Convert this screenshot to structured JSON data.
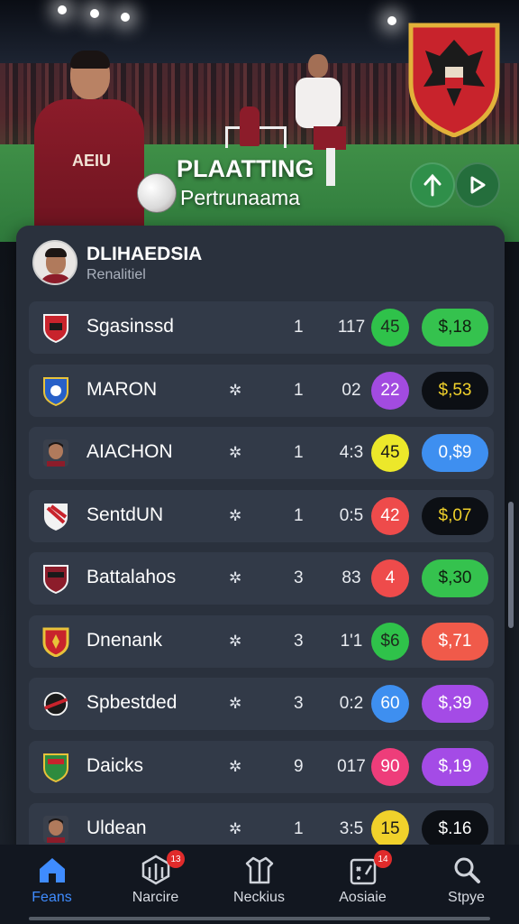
{
  "hero": {
    "title": "PLAATTING",
    "subtitle": "Pertrunaama",
    "jersey_text": "AEIU",
    "buttons": [
      {
        "icon": "arrow-up-icon"
      },
      {
        "icon": "chevron-right-icon"
      }
    ]
  },
  "panel": {
    "title": "DLIHAEDSIA",
    "subtitle": "Renalitiel"
  },
  "rows": [
    {
      "name": "Sgasinssd",
      "star": "",
      "n1": "1",
      "n2": "117",
      "circle": "45",
      "circle_color": "#2fc24a",
      "circle_text": "#1d2a1d",
      "pill": "$,18",
      "pill_color": "#35c24e",
      "pill_text": "#0f1f0f",
      "logo": "shield-red-icon"
    },
    {
      "name": "MARON",
      "star": "✲",
      "n1": "1",
      "n2": "02",
      "circle": "22",
      "circle_color": "#a24be0",
      "circle_text": "#ffffff",
      "pill": "$,53",
      "pill_color": "#0c0f14",
      "pill_text": "#f0d12b",
      "logo": "shield-blue-icon"
    },
    {
      "name": "AIACHON",
      "star": "✲",
      "n1": "1",
      "n2": "4:3",
      "circle": "45",
      "circle_color": "#ece82a",
      "circle_text": "#1a1a1a",
      "pill": "0,$9",
      "pill_color": "#3e8ff0",
      "pill_text": "#ffffff",
      "logo": "player-face-icon"
    },
    {
      "name": "SentdUN",
      "star": "✲",
      "n1": "1",
      "n2": "0:5",
      "circle": "42",
      "circle_color": "#ee4b4b",
      "circle_text": "#ffffff",
      "pill": "$,07",
      "pill_color": "#0c0f14",
      "pill_text": "#f0d12b",
      "logo": "shield-white-icon"
    },
    {
      "name": "Battalahos",
      "star": "✲",
      "n1": "3",
      "n2": "83",
      "circle": "4",
      "circle_color": "#ee4b4b",
      "circle_text": "#ffffff",
      "pill": "$,30",
      "pill_color": "#35c24e",
      "pill_text": "#0f1f0f",
      "logo": "shield-maroon-icon"
    },
    {
      "name": "Dnenank",
      "star": "✲",
      "n1": "3",
      "n2": "1'1",
      "circle": "$6",
      "circle_color": "#2fc24a",
      "circle_text": "#1d2a1d",
      "pill": "$,71",
      "pill_color": "#f05a4a",
      "pill_text": "#ffffff",
      "logo": "shield-gold-icon"
    },
    {
      "name": "Spbestded",
      "star": "✲",
      "n1": "3",
      "n2": "0:2",
      "circle": "60",
      "circle_color": "#3e8ff0",
      "circle_text": "#ffffff",
      "pill": "$,39",
      "pill_color": "#a44be6",
      "pill_text": "#ffffff",
      "logo": "club-dark-icon"
    },
    {
      "name": "Daicks",
      "star": "✲",
      "n1": "9",
      "n2": "017",
      "circle": "90",
      "circle_color": "#ee3d7a",
      "circle_text": "#ffffff",
      "pill": "$,19",
      "pill_color": "#a44be6",
      "pill_text": "#ffffff",
      "logo": "shield-green-icon"
    },
    {
      "name": "Uldean",
      "star": "✲",
      "n1": "1",
      "n2": "3:5",
      "circle": "15",
      "circle_color": "#f0d12b",
      "circle_text": "#1a1a1a",
      "pill": "$.16",
      "pill_color": "#0c0f14",
      "pill_text": "#ffffff",
      "logo": "player-face-icon"
    }
  ],
  "nav": [
    {
      "label": "Feans",
      "icon": "home-icon",
      "badge": ""
    },
    {
      "label": "Narcire",
      "icon": "hexagon-icon",
      "badge": "13"
    },
    {
      "label": "Neckius",
      "icon": "shirt-icon",
      "badge": ""
    },
    {
      "label": "Aosiaie",
      "icon": "tactics-board-icon",
      "badge": "14"
    },
    {
      "label": "Stpye",
      "icon": "search-icon",
      "badge": ""
    }
  ]
}
